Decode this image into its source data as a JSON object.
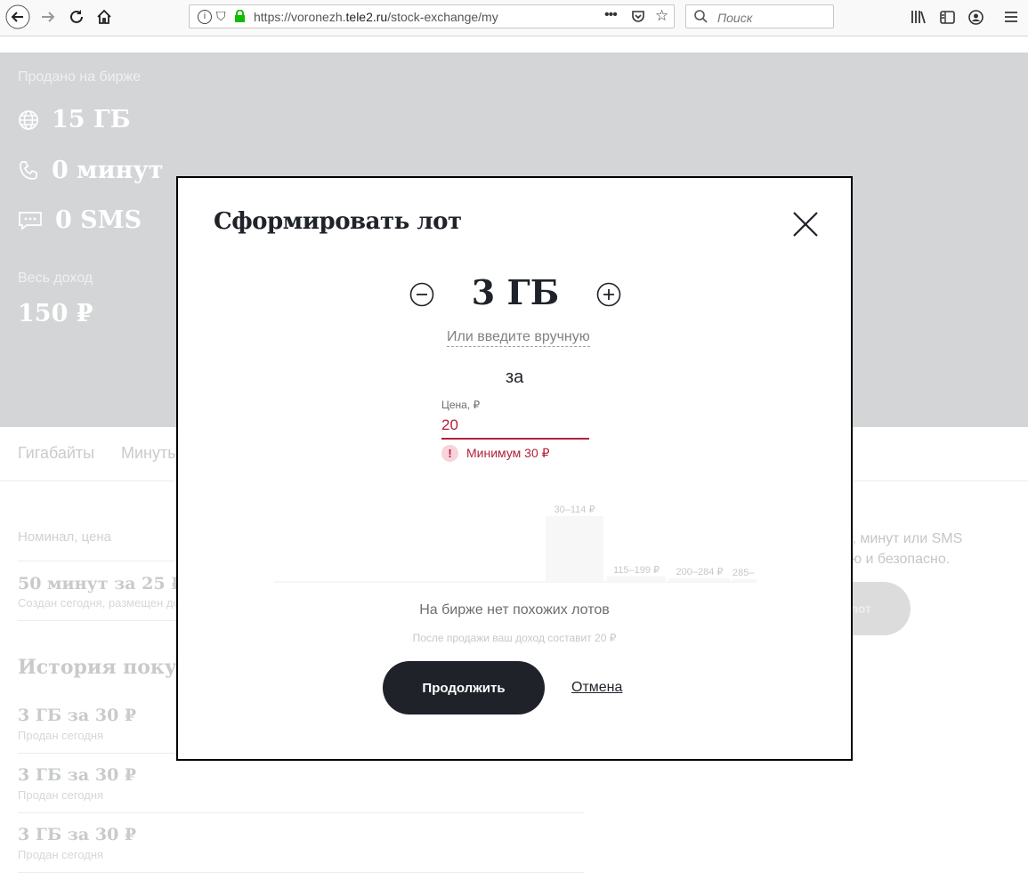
{
  "browser": {
    "url_prefix": "https://voronezh.",
    "url_domain": "tele2.ru",
    "url_path": "/stock-exchange/my",
    "search_placeholder": "Поиск"
  },
  "hero": {
    "sold_label": "Продано на бирже",
    "stats": [
      "15 ГБ",
      "0 минут",
      "0 SMS"
    ],
    "income_label": "Весь доход",
    "income_value": "150 ₽"
  },
  "tabs": [
    "Гигабайты",
    "Минуты"
  ],
  "background": {
    "nominal_header": "Номинал, цена",
    "lot_title": "50 минут за 25 ₽",
    "lot_sub": "Создан сегодня, размещен до",
    "history_title": "История покупок",
    "history": [
      {
        "title": "3 ГБ за 30 ₽",
        "sub": "Продан сегодня"
      },
      {
        "title": "3 ГБ за 30 ₽",
        "sub": "Продан сегодня"
      },
      {
        "title": "3 ГБ за 30 ₽",
        "sub": "Продан сегодня"
      }
    ],
    "promo_line1": "йт, минут или SMS",
    "promo_line2": "ю и безопасно.",
    "pill_label": "лот"
  },
  "modal": {
    "title": "Сформировать лот",
    "amount": "3 ГБ",
    "manual_link": "Или введите вручную",
    "for_label": "за",
    "price_label": "Цена, ₽",
    "price_value": "20",
    "error": "Минимум 30 ₽",
    "no_lots": "На бирже нет похожих лотов",
    "income_note": "После продажи ваш доход составит 20 ₽",
    "continue_label": "Продолжить",
    "cancel_label": "Отмена"
  },
  "chart_data": {
    "type": "bar",
    "categories": [
      "30–114 ₽",
      "115–199 ₽",
      "200–284 ₽",
      "285–"
    ],
    "values": [
      1,
      0.07,
      0.04,
      0.03
    ]
  }
}
